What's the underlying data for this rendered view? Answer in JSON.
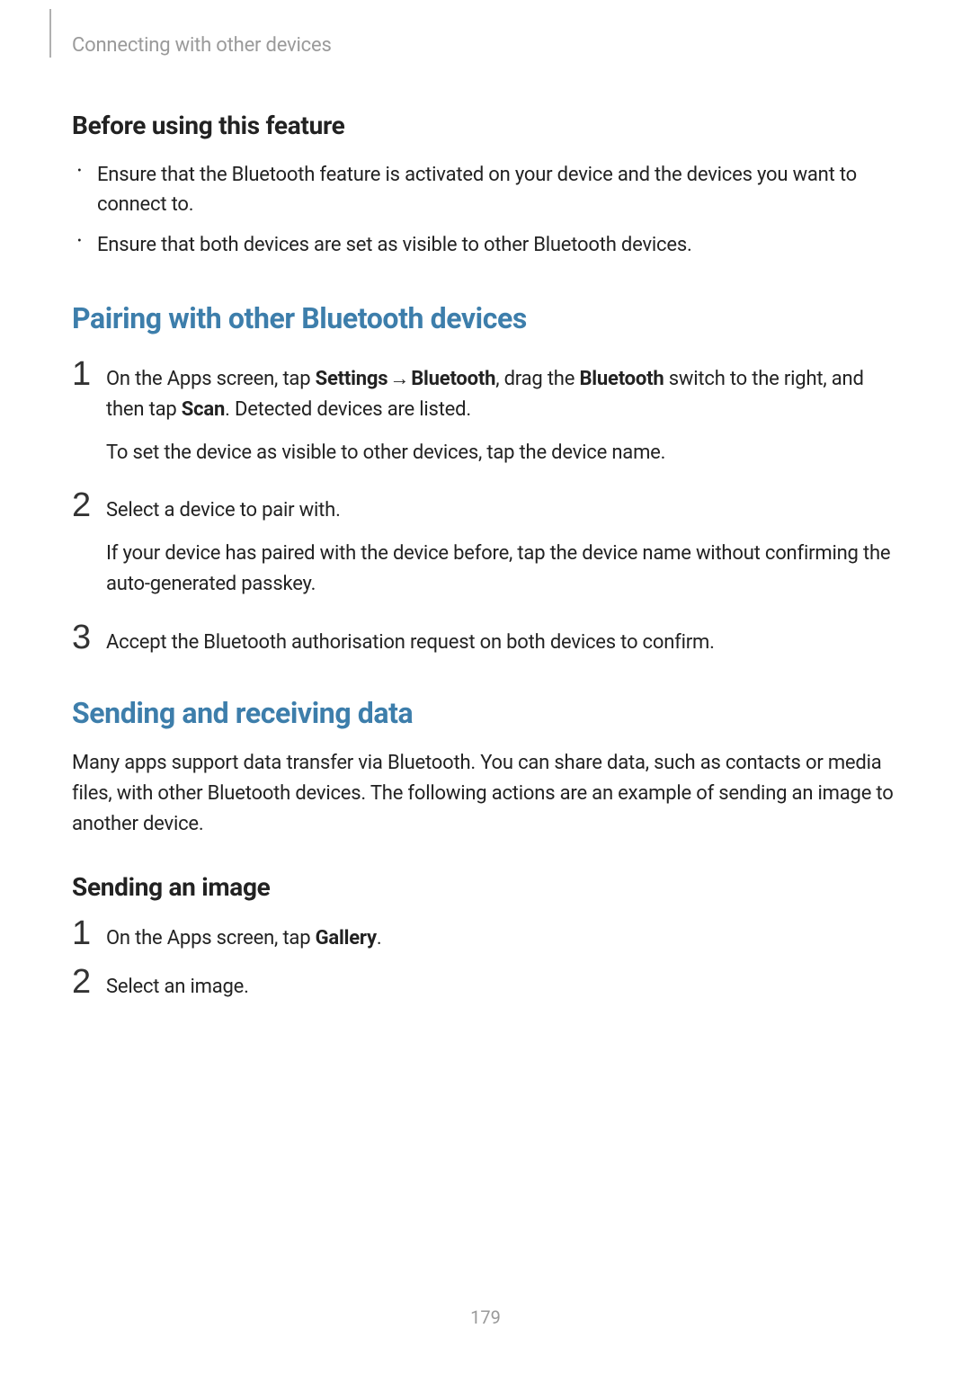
{
  "header": {
    "breadcrumb": "Connecting with other devices"
  },
  "section1": {
    "heading": "Before using this feature",
    "bullets": [
      "Ensure that the Bluetooth feature is activated on your device and the devices you want to connect to.",
      "Ensure that both devices are set as visible to other Bluetooth devices."
    ]
  },
  "section2": {
    "heading": "Pairing with other Bluetooth devices",
    "steps": [
      {
        "num": "1",
        "p1_pre": "On the Apps screen, tap ",
        "p1_b1": "Settings",
        "p1_arrow": " → ",
        "p1_b2": "Bluetooth",
        "p1_mid1": ", drag the ",
        "p1_b3": "Bluetooth",
        "p1_mid2": " switch to the right, and then tap ",
        "p1_b4": "Scan",
        "p1_post": ". Detected devices are listed.",
        "p2": "To set the device as visible to other devices, tap the device name."
      },
      {
        "num": "2",
        "p1": "Select a device to pair with.",
        "p2": "If your device has paired with the device before, tap the device name without confirming the auto-generated passkey."
      },
      {
        "num": "3",
        "p1": "Accept the Bluetooth authorisation request on both devices to confirm."
      }
    ]
  },
  "section3": {
    "heading": "Sending and receiving data",
    "intro": "Many apps support data transfer via Bluetooth. You can share data, such as contacts or media files, with other Bluetooth devices. The following actions are an example of sending an image to another device.",
    "subheading": "Sending an image",
    "steps": [
      {
        "num": "1",
        "p1_pre": "On the Apps screen, tap ",
        "p1_b1": "Gallery",
        "p1_post": "."
      },
      {
        "num": "2",
        "p1": "Select an image."
      }
    ]
  },
  "page_number": "179"
}
